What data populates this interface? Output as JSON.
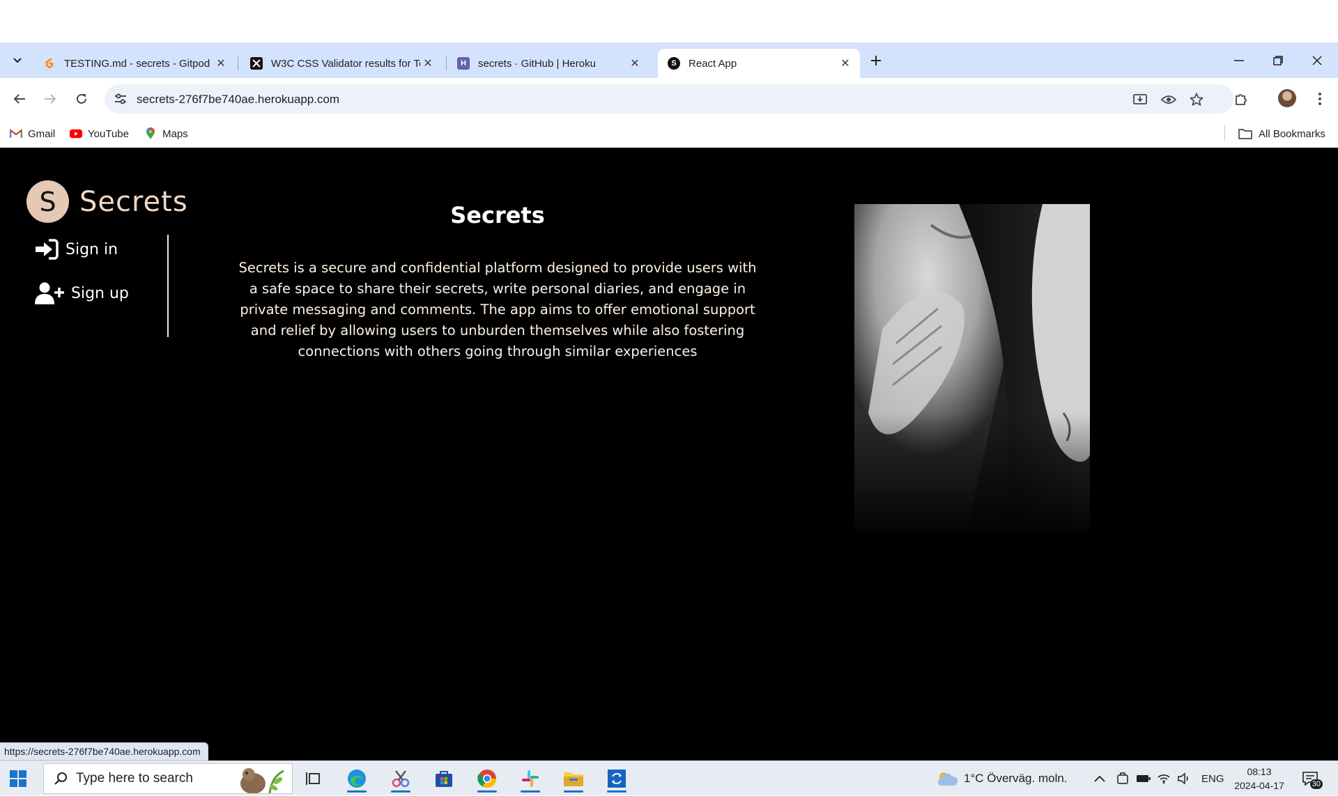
{
  "browser": {
    "tabs": [
      {
        "title": "TESTING.md - secrets - Gitpod",
        "favicon": "gitpod-icon",
        "color": "#ff8a00"
      },
      {
        "title": "W3C CSS Validator results for Te",
        "favicon": "w3c-icon",
        "color": "#111111"
      },
      {
        "title": "secrets · GitHub | Heroku",
        "favicon": "heroku-icon",
        "color": "#6762a6"
      },
      {
        "title": "React App",
        "favicon": "secrets-s-icon",
        "color": "#111111",
        "active": true
      }
    ],
    "url": "secrets-276f7be740ae.herokuapp.com",
    "bookmarks": [
      {
        "label": "Gmail",
        "icon": "gmail-icon"
      },
      {
        "label": "YouTube",
        "icon": "youtube-icon"
      },
      {
        "label": "Maps",
        "icon": "maps-icon"
      }
    ],
    "all_bookmarks": "All Bookmarks",
    "status_url": "https://secrets-276f7be740ae.herokuapp.com"
  },
  "page": {
    "brand_initial": "S",
    "brand_name": "Secrets",
    "nav": [
      {
        "label": "Sign in",
        "icon": "sign-in-icon"
      },
      {
        "label": "Sign up",
        "icon": "user-plus-icon"
      }
    ],
    "title": "Secrets",
    "description": "Secrets is a secure and confidential platform designed to provide users with a safe space to share their secrets, write personal diaries, and engage in private messaging and comments. The app aims to offer emotional support and relief by allowing users to unburden themselves while also fostering connections with others going through similar experiences",
    "colors": {
      "background": "#000000",
      "accent": "#e6c9b4",
      "text": "#fff1e4"
    }
  },
  "taskbar": {
    "search_placeholder": "Type here to search",
    "weather": "1°C  Överväg. moln.",
    "language": "ENG",
    "time": "08:13",
    "date": "2024-04-17",
    "notification_count": "30"
  }
}
